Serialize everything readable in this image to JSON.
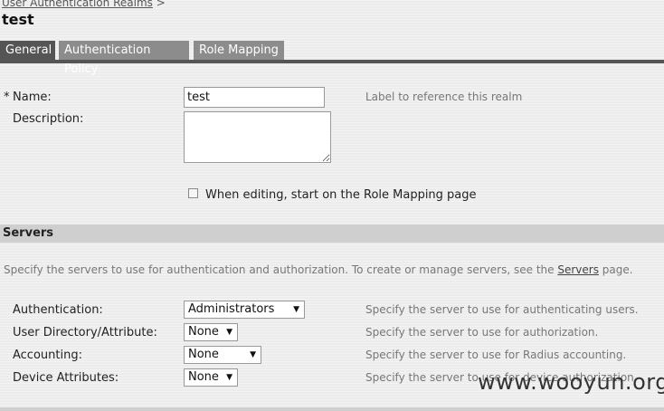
{
  "breadcrumb": {
    "parent": "User Authentication Realms",
    "separator": ">"
  },
  "page": {
    "title": "test"
  },
  "tabs": [
    {
      "label": "General",
      "active": true
    },
    {
      "label": "Authentication Policy",
      "active": false
    },
    {
      "label": "Role Mapping",
      "active": false
    }
  ],
  "general": {
    "required_mark": "*",
    "name_label": "Name:",
    "name_value": "test",
    "name_hint": "Label to reference this realm",
    "description_label": "Description:",
    "description_value": "",
    "edit_checkbox_label": "When editing, start on the Role Mapping page",
    "edit_checkbox_checked": false
  },
  "servers": {
    "title": "Servers",
    "description_prefix": "Specify the servers to use for authentication and authorization. To create or manage servers, see the",
    "description_link": "Servers",
    "description_suffix": "page.",
    "rows": [
      {
        "label": "Authentication:",
        "value": "Administrators",
        "hint": "Specify the server to use for authenticating users."
      },
      {
        "label": "User Directory/Attribute:",
        "value": "None",
        "hint": "Specify the server to use for authorization."
      },
      {
        "label": "Accounting:",
        "value": "None",
        "hint": "Specify the server to use for Radius accounting."
      },
      {
        "label": "Device Attributes:",
        "value": "None",
        "hint": "Specify the server to use for device authorization."
      }
    ]
  },
  "icons": {
    "dropdown_arrow": "▼"
  },
  "watermark": "www.wooyun.org"
}
